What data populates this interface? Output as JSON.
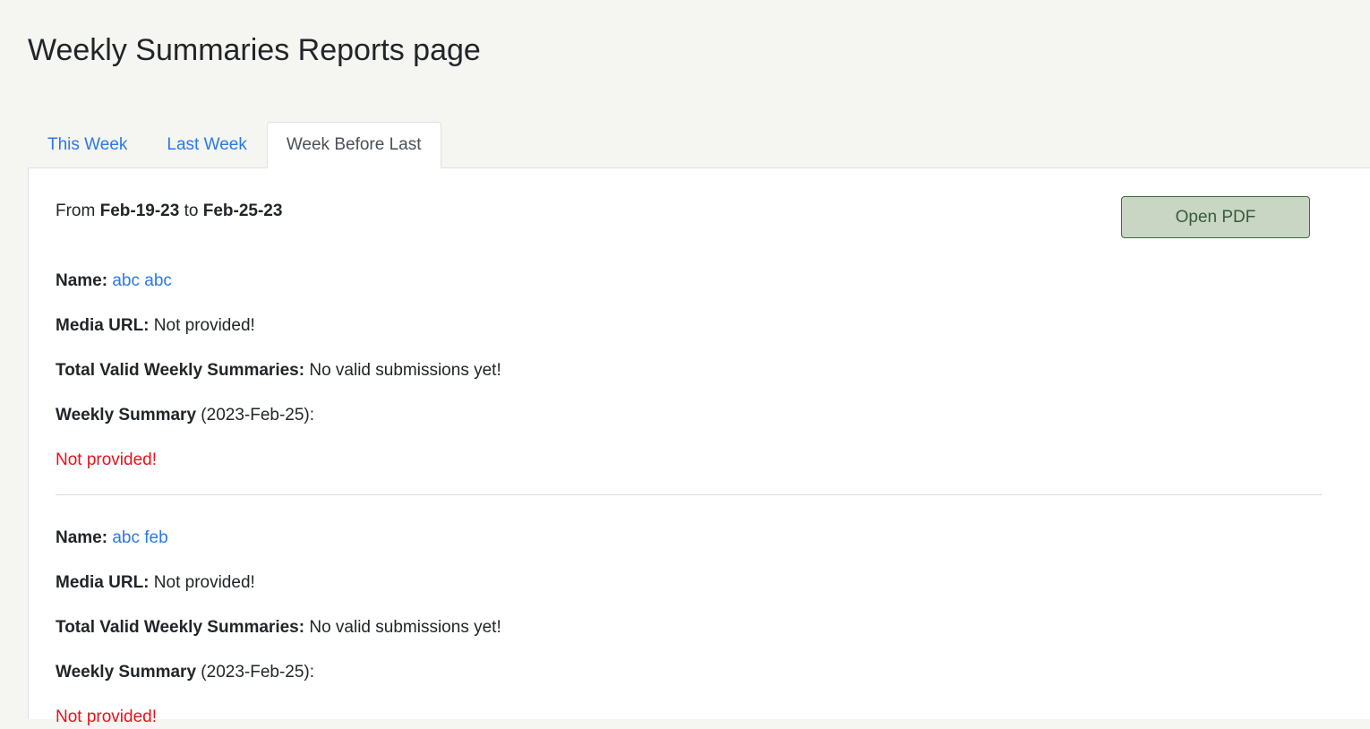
{
  "page": {
    "title": "Weekly Summaries Reports page"
  },
  "tabs": [
    {
      "label": "This Week",
      "active": false
    },
    {
      "label": "Last Week",
      "active": false
    },
    {
      "label": "Week Before Last",
      "active": true
    }
  ],
  "report": {
    "from_word": "From",
    "from_date": "Feb-19-23",
    "to_word": "to",
    "to_date": "Feb-25-23",
    "open_pdf_label": "Open PDF"
  },
  "labels": {
    "name": "Name:",
    "media_url": "Media URL:",
    "total_valid": "Total Valid Weekly Summaries:",
    "weekly_summary": "Weekly Summary"
  },
  "entries": [
    {
      "name": "abc abc",
      "media_url": "Not provided!",
      "total_valid": "No valid submissions yet!",
      "summary_date": "(2023-Feb-25):",
      "summary_text": "Not provided!"
    },
    {
      "name": "abc feb",
      "media_url": "Not provided!",
      "total_valid": "No valid submissions yet!",
      "summary_date": "(2023-Feb-25):",
      "summary_text": "Not provided!"
    }
  ],
  "colors": {
    "background": "#f5f5f1",
    "link": "#2a7ae2",
    "missing": "#e3131b",
    "pdf_button_bg": "#c8d6c3",
    "pdf_button_border": "#3f6b40"
  }
}
